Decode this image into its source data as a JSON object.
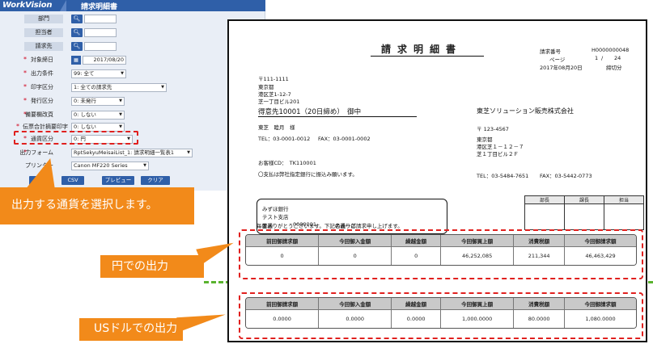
{
  "app": {
    "logo": "WorkVision",
    "title": "請求明細書",
    "fields": [
      {
        "label": "部門",
        "type": "search",
        "required": false
      },
      {
        "label": "担当者",
        "type": "search",
        "required": false
      },
      {
        "label": "請求先",
        "type": "search",
        "required": false
      },
      {
        "label": "対象締日",
        "type": "date",
        "value": "2017/08/20",
        "required": true
      },
      {
        "label": "出力条件",
        "type": "select",
        "value": "99: 全て",
        "required": true
      },
      {
        "label": "印字区分",
        "type": "select",
        "value": "1: 全ての請求先",
        "required": true
      },
      {
        "label": "発行区分",
        "type": "select",
        "value": "0: 未発行",
        "required": true
      },
      {
        "label": "備要欄改頁",
        "type": "select",
        "value": "0: しない",
        "required": true
      },
      {
        "label": "伝票合計摘要印字",
        "type": "select",
        "value": "0: しない",
        "required": true
      },
      {
        "label": "通貨区分",
        "type": "select",
        "value": "0: 円",
        "required": true
      },
      {
        "label": "出力フォーム",
        "type": "select",
        "value": "RptSekyuMeisaiList_1: 請求明細一覧表1",
        "required": true
      },
      {
        "label": "プリンター",
        "type": "select",
        "value": "Canon MF220 Series",
        "required": false
      }
    ],
    "buttons": [
      "印刷",
      "CSV",
      "プレビュー",
      "クリア"
    ]
  },
  "callouts": {
    "main": "出力する通貨を選択します。",
    "jpy": "円での出力",
    "usd": "USドルでの出力"
  },
  "doc": {
    "title": "請求明細書",
    "invoice_no_label": "請求番号",
    "invoice_no": "H0000000048",
    "page_label": "ページ",
    "page": "1",
    "page_total": "24",
    "date": "2017年08月20日",
    "closing": "締切分",
    "to": {
      "zip": "〒111-1111",
      "line1": "東京都",
      "line2": "港区芝1-12-7",
      "line3": "芝一丁目ビル201",
      "name": "得意先10001（20日締め）　御中",
      "person": "東芝　睦月　様",
      "tel": "TEL：03-0001-0012",
      "fax": "FAX：03-0001-0002",
      "customer_cd": "お客様CD：　TK110001",
      "note": "〇支払は弊社指定銀行に振込み願います。"
    },
    "from": {
      "company": "東芝ソリューション販売株式会社",
      "zip": "〒 123-4567",
      "line1": "東京都",
      "line2": "港区芝１－１２－７",
      "line3": "芝１丁目ビル２Ｆ",
      "tel": "TEL：03-5484-7651",
      "fax": "FAX：03-5442-0773"
    },
    "bank": {
      "name": "みずほ銀行",
      "branch": "テスト支店",
      "type": "普通",
      "account": "0000001",
      "holder": "名義一郎"
    },
    "stamps": [
      "部長",
      "課長",
      "担当"
    ],
    "thanks": "毎度ありがとうございます。下記の通りご請求申し上げます。",
    "columns": [
      "前回御請求額",
      "今回御入金額",
      "繰越金額",
      "今回御買上額",
      "消費税額",
      "今回御請求額"
    ],
    "jpy_values": [
      "0",
      "0",
      "0",
      "46,252,085",
      "211,344",
      "46,463,429"
    ],
    "usd_values": [
      "0.0000",
      "0.0000",
      "0.0000",
      "1,000.0000",
      "80.0000",
      "1,080.0000"
    ]
  },
  "colors": {
    "brand": "#2f5fa8",
    "callout": "#f28a1a",
    "highlight": "#e0201e",
    "separator": "#5ab32e"
  }
}
